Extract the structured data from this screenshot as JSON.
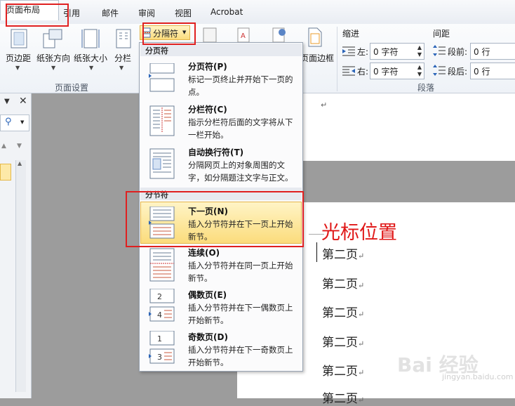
{
  "tabs": [
    "页面布局",
    "引用",
    "邮件",
    "审阅",
    "视图",
    "Acrobat"
  ],
  "ribbon": {
    "buttons": {
      "margins": "页边距",
      "orientation": "纸张方向",
      "size": "纸张大小",
      "columns": "分栏",
      "breaks": "分隔符",
      "page_borders": "页面边框"
    },
    "page_setup_label": "页面设置",
    "indent_label": "缩进",
    "spacing_label": "间距",
    "paragraph_label": "段落",
    "indent_left_label": "左:",
    "indent_left_value": "0 字符",
    "indent_right_label": "右:",
    "indent_right_value": "0 字符",
    "spacing_before_label": "段前:",
    "spacing_before_value": "0 行",
    "spacing_after_label": "段后:",
    "spacing_after_value": "0 行"
  },
  "menu": {
    "section_page_breaks": "分页符",
    "section_section_breaks": "分节符",
    "items": [
      {
        "title": "分页符(P)",
        "desc": "标记一页终止并开始下一页的点。"
      },
      {
        "title": "分栏符(C)",
        "desc": "指示分栏符后面的文字将从下一栏开始。"
      },
      {
        "title": "自动换行符(T)",
        "desc": "分隔网页上的对象周围的文字，如分隔题注文字与正文。"
      },
      {
        "title": "下一页(N)",
        "desc": "插入分节符并在下一页上开始新节。"
      },
      {
        "title": "连续(O)",
        "desc": "插入分节符并在同一页上开始新节。"
      },
      {
        "title": "偶数页(E)",
        "desc": "插入分节符并在下一偶数页上开始新节。"
      },
      {
        "title": "奇数页(D)",
        "desc": "插入分节符并在下一奇数页上开始新节。"
      }
    ]
  },
  "document": {
    "annotation": "光标位置",
    "lines": [
      "第二页",
      "第二页",
      "第二页",
      "第二页",
      "第二页",
      "第二页"
    ],
    "return_mark": "↵"
  },
  "watermark": {
    "main": "Bai 经验",
    "sub": "jingyan.baidu.com"
  }
}
